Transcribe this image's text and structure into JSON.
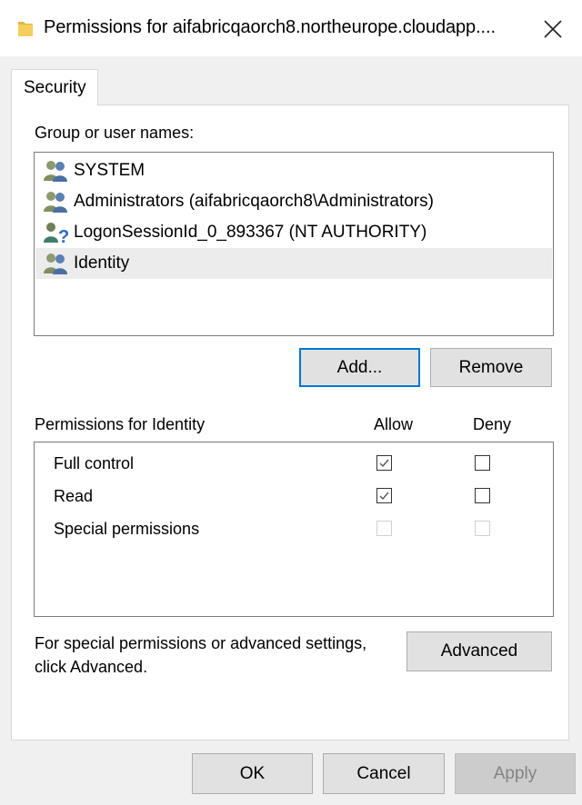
{
  "window": {
    "title": "Permissions for aifabricqaorch8.northeurope.cloudapp....",
    "icon": "folder-icon"
  },
  "tabs": [
    {
      "label": "Security",
      "active": true
    }
  ],
  "users": {
    "label": "Group or user names:",
    "items": [
      {
        "name": "SYSTEM",
        "icon": "users-group-icon",
        "selected": false
      },
      {
        "name": "Administrators (aifabricqaorch8\\Administrators)",
        "icon": "users-group-icon",
        "selected": false
      },
      {
        "name": "LogonSessionId_0_893367 (NT AUTHORITY)",
        "icon": "unknown-user-icon",
        "selected": false
      },
      {
        "name": "Identity",
        "icon": "users-group-icon",
        "selected": true
      }
    ]
  },
  "buttons": {
    "add": "Add...",
    "remove": "Remove",
    "advanced": "Advanced",
    "ok": "OK",
    "cancel": "Cancel",
    "apply": "Apply"
  },
  "permissions": {
    "label": "Permissions for Identity",
    "allow_header": "Allow",
    "deny_header": "Deny",
    "rows": [
      {
        "name": "Full control",
        "allow": true,
        "deny": false,
        "enabled": true
      },
      {
        "name": "Read",
        "allow": true,
        "deny": false,
        "enabled": true
      },
      {
        "name": "Special permissions",
        "allow": false,
        "deny": false,
        "enabled": false
      }
    ]
  },
  "advanced_hint": {
    "line1": "For special permissions or advanced settings,",
    "line2": "click Advanced."
  },
  "colors": {
    "accent": "#0078d7",
    "panel_bg": "#ffffff",
    "window_bg": "#f0f0f0",
    "selected_row": "#ececec"
  }
}
